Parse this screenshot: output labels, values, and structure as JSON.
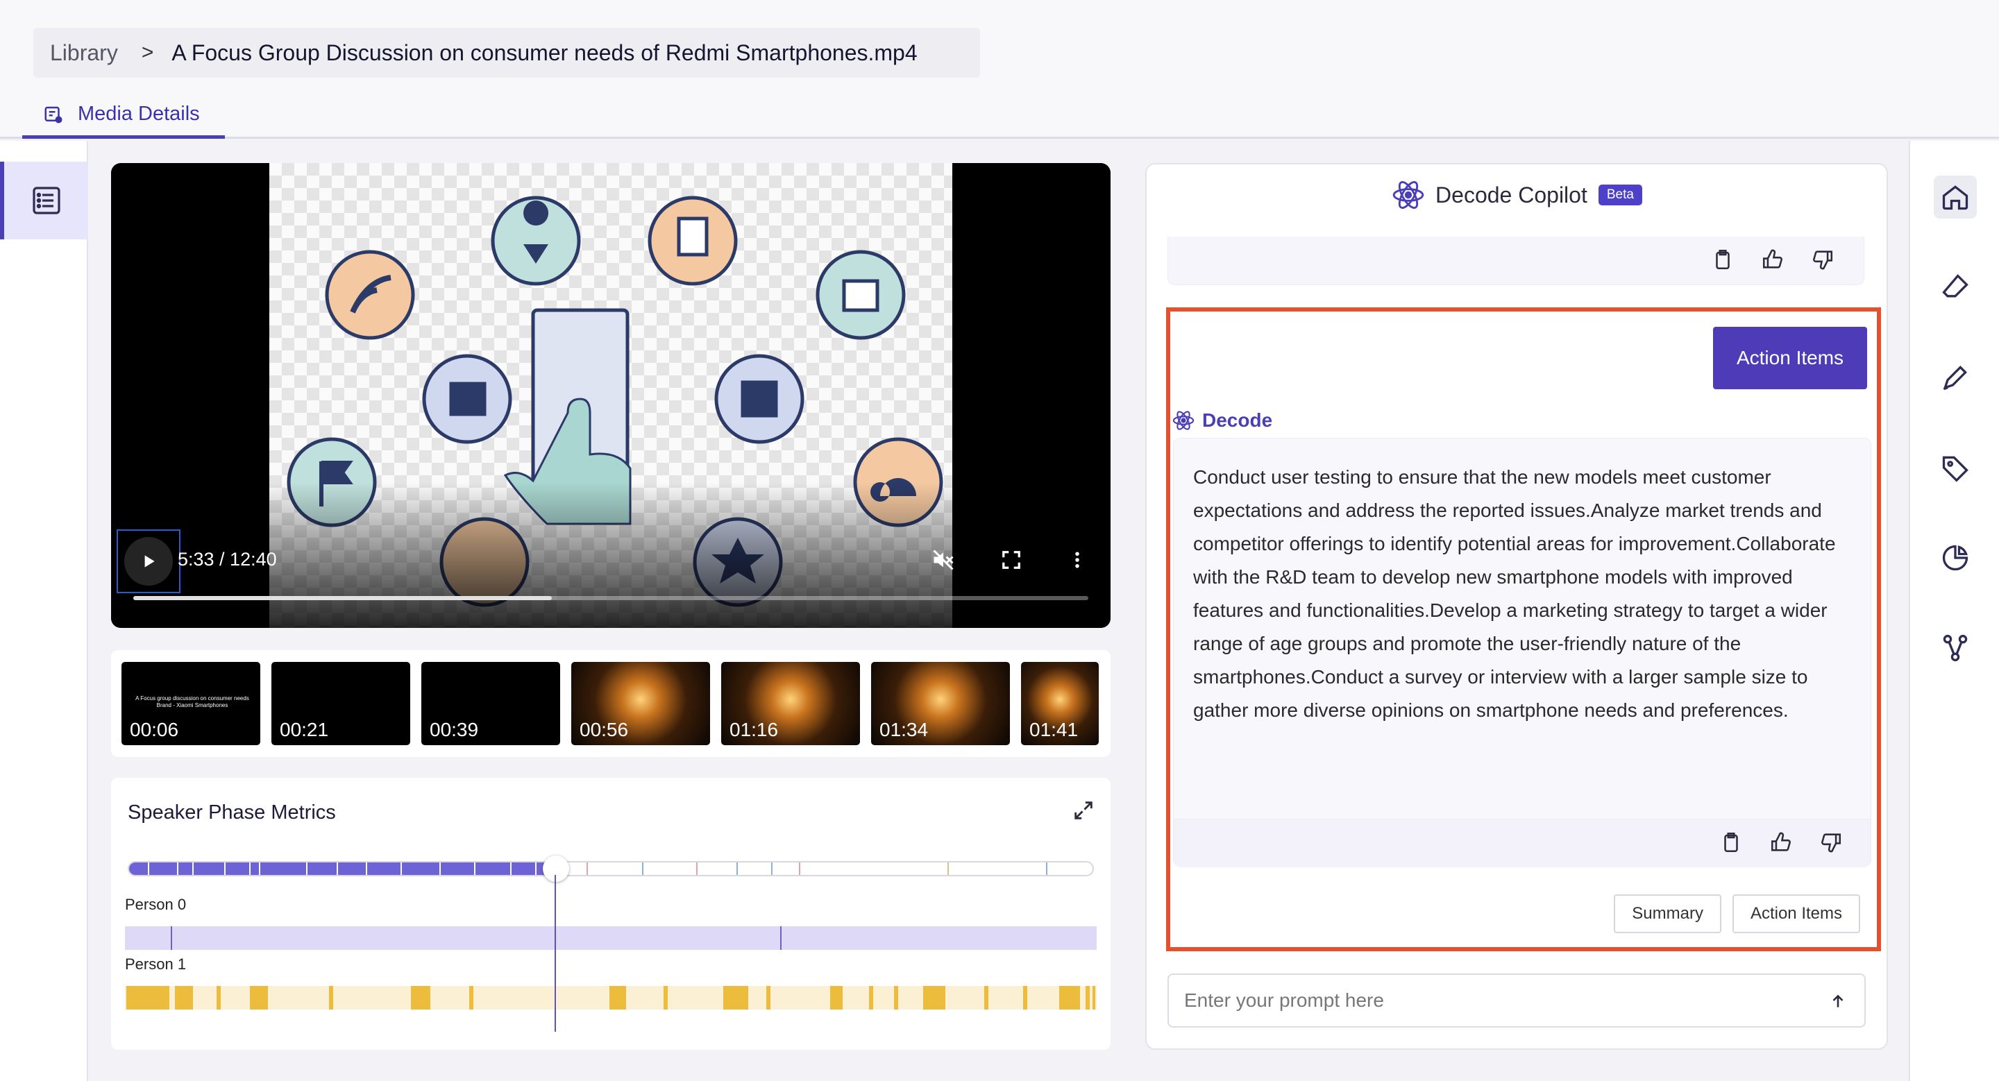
{
  "header": {
    "breadcrumb": {
      "root": "Library",
      "separator": ">",
      "current": "A Focus Group Discussion on consumer needs of Redmi Smartphones.mp4"
    },
    "tab_label": "Media Details"
  },
  "video": {
    "time": "5:33 / 12:40",
    "progress_fraction": 0.438,
    "icons": [
      "play-icon",
      "mute-icon",
      "fullscreen-icon",
      "more-vertical-icon"
    ]
  },
  "thumbnails": [
    {
      "time": "00:06",
      "caption": "A Focus group discussion on consumer needs\nBrand - Xiaomi Smartphones"
    },
    {
      "time": "00:21"
    },
    {
      "time": "00:39"
    },
    {
      "time": "00:56"
    },
    {
      "time": "01:16"
    },
    {
      "time": "01:34"
    },
    {
      "time": "01:41"
    }
  ],
  "metrics": {
    "title": "Speaker Phase Metrics",
    "persons": [
      "Person 0",
      "Person 1"
    ],
    "playhead_fraction": 0.44
  },
  "copilot": {
    "title": "Decode Copilot",
    "badge": "Beta",
    "user_message": "Action Items",
    "assistant_name": "Decode",
    "answer": "Conduct user testing to ensure that the new models meet customer expectations and address the reported issues.Analyze market trends and competitor offerings to identify potential areas for improvement.Collaborate with the R&D team to develop new smartphone models with improved features and functionalities.Develop a marketing strategy to target a wider range of age groups and promote the user-friendly nature of the smartphones.Conduct a survey or interview with a larger sample size to gather more diverse opinions on smartphone needs and preferences.",
    "quick_actions": [
      "Summary",
      "Action Items"
    ],
    "prompt_placeholder": "Enter your prompt here"
  },
  "colors": {
    "accent": "#4b3fb5",
    "highlight_border": "#e5502e",
    "person1": "#ecbd3c",
    "timeline": "#6e63d6"
  }
}
